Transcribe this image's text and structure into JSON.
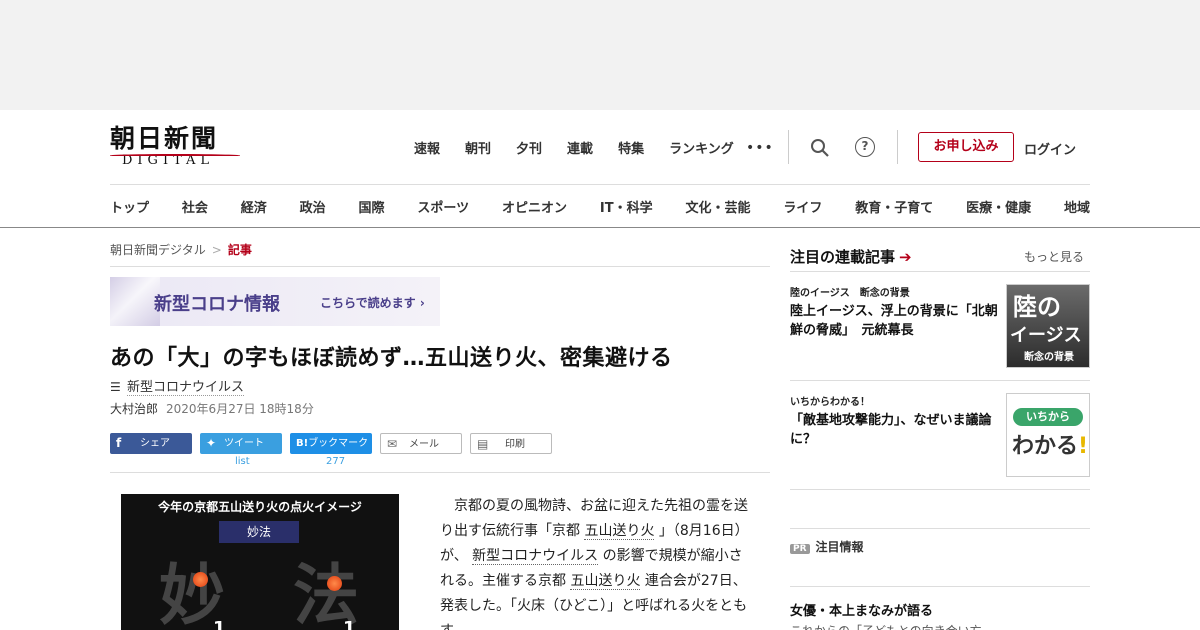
{
  "logo": {
    "jp": "朝日新聞",
    "en": "DIGITAL"
  },
  "top_nav": [
    "速報",
    "朝刊",
    "夕刊",
    "連載",
    "特集",
    "ランキング"
  ],
  "more_label": "•••",
  "help_label": "?",
  "subscribe_label": "お申し込み",
  "login_label": "ログイン",
  "categories": [
    "トップ",
    "社会",
    "経済",
    "政治",
    "国際",
    "スポーツ",
    "オピニオン",
    "IT・科学",
    "文化・芸能",
    "ライフ",
    "教育・子育て",
    "医療・健康",
    "地域"
  ],
  "breadcrumb": {
    "home": "朝日新聞デジタル",
    "sep": ">",
    "current": "記事"
  },
  "corona_banner": {
    "title": "新型コロナ情報",
    "link": "こちらで読めます ›"
  },
  "article": {
    "headline": "あの「大」の字もほぼ読めず…五山送り火、密集避ける",
    "topic": "新型コロナウイルス",
    "author": "大村治郎",
    "date": "2020年6月27日 18時18分",
    "body_1": "京都の夏の風物詩、お盆に迎えた先祖の霊を送り出す伝統行事「京都 ",
    "link_1": "五山送り火",
    "body_2": " 」（8月16日）が、 ",
    "link_2": "新型コロナウイルス",
    "body_3": " の影響で規模が縮小される。主催する京都 ",
    "link_3": "五山送り火",
    "body_4": " 連合会が27日、発表した。「火床（ひどこ）」と呼ばれる火をともす"
  },
  "share": {
    "facebook": "シェア",
    "twitter": "ツイート",
    "twitter_count": "list",
    "hatena": "ブックマーク",
    "hatena_count": "277",
    "mail": "メール",
    "print": "印刷"
  },
  "figure": {
    "caption": "今年の京都五山送り火の点火イメージ",
    "tag": "妙法",
    "kanji_1": "妙",
    "kanji_2": "法",
    "num_1": "1",
    "num_2": "1"
  },
  "sidebar": {
    "heading": "注目の連載記事",
    "more": "もっと見る",
    "items": [
      {
        "sub": "陸のイージス　断念の背景",
        "title": "陸上イージス、浮上の背景に「北朝鮮の脅威」　元統幕長"
      },
      {
        "sub": "いちからわかる！",
        "title": "「敵基地攻撃能力」、なぜいま議論に？"
      }
    ],
    "thumb_1": {
      "a": "陸の",
      "b": "イージス",
      "c": "断念の背景"
    },
    "thumb_2": {
      "pill": "いちから",
      "word": "わかる",
      "ex": "!"
    },
    "pr_badge": "PR",
    "pr_label": "注目情報",
    "bottom_title": "女優・本上まなみが語る",
    "bottom_sub": "これからの「子どもとの向き合い方"
  }
}
